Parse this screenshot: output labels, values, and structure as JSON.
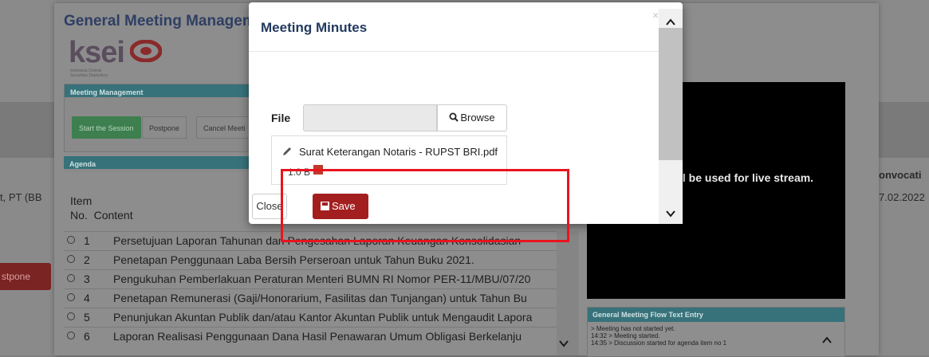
{
  "background_page": {
    "left_partial_text": "t, PT (BB",
    "right_header_partial": "onvocati",
    "right_date_partial": "7.02.2022",
    "postpone_partial": "stpone"
  },
  "panel": {
    "title": "General Meeting Manageme",
    "logo_text": "ksei",
    "logo_subtitle": "Indonesia Central Securities Depository",
    "meeting_management": {
      "header": "Meeting Management",
      "buttons": [
        "Start the Session",
        "Postpone",
        "Cancel Meeti"
      ]
    },
    "agenda": {
      "header": "Agenda",
      "col_item": "Item",
      "col_no": "No.",
      "col_content": "Content",
      "rows": [
        {
          "no": "1",
          "content": "Persetujuan Laporan Tahunan dan Pengesahan Laporan Keuangan Konsolidasian"
        },
        {
          "no": "2",
          "content": "Penetapan Penggunaan Laba Bersih Perseroan untuk Tahun Buku 2021."
        },
        {
          "no": "3",
          "content": "Pengukuhan Pemberlakuan Peraturan Menteri BUMN RI Nomor PER-11/MBU/07/20"
        },
        {
          "no": "4",
          "content": "Penetapan Remunerasi (Gaji/Honorarium, Fasilitas dan Tunjangan) untuk Tahun Bu"
        },
        {
          "no": "5",
          "content": "Penunjukan Akuntan Publik dan/atau Kantor Akuntan Publik untuk Mengaudit Lapora"
        },
        {
          "no": "6",
          "content": "Laporan Realisasi Penggunaan Dana Hasil Penawaran Umum Obligasi Berkelanju"
        }
      ]
    },
    "video_text": "ll be used for live stream.",
    "flow": {
      "header": "General Meeting Flow Text Entry",
      "lines": [
        "> Meeting has not started yet.",
        "14:32 > Meeting started.",
        "14:35 > Discussion started for agenda item no 1"
      ]
    }
  },
  "modal": {
    "title": "Meeting Minutes",
    "close_x": "×",
    "file_label": "File",
    "file_value": "",
    "browse_label": "Browse",
    "file_name": "Surat Keterangan Notaris - RUPST BRI.pdf",
    "file_size": "1.0 B",
    "close_button": "Close",
    "save_button": "Save"
  },
  "icons": {
    "browse": "search-icon",
    "file": "pencil-icon",
    "delete": "trash-icon",
    "save": "floppy-disk-icon"
  },
  "colors": {
    "save_button": "#a31f1f",
    "highlight": "#e8141e",
    "header_teal": "#37727a",
    "title": "#223a5e"
  }
}
